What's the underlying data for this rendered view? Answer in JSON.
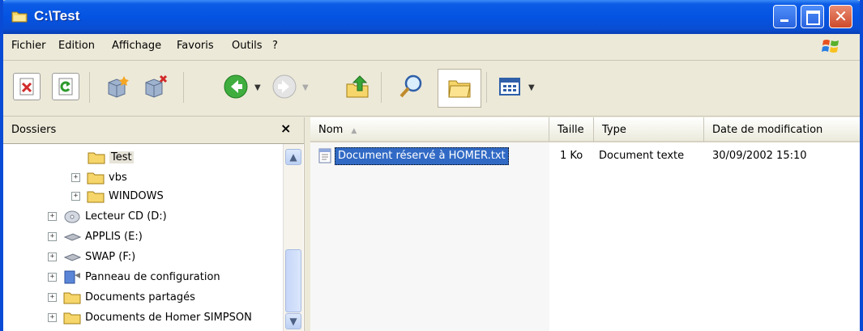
{
  "window": {
    "title": "C:\\Test"
  },
  "menu": [
    "Fichier",
    "Edition",
    "Affichage",
    "Favoris",
    "Outils",
    "?"
  ],
  "folders_pane": {
    "title": "Dossiers",
    "close_glyph": "×",
    "tree": [
      {
        "label": "Test",
        "expander": "",
        "selected": true
      },
      {
        "label": "vbs",
        "expander": "+"
      },
      {
        "label": "WINDOWS",
        "expander": "+"
      },
      {
        "label": "Lecteur CD (D:)",
        "expander": "+"
      },
      {
        "label": "APPLIS (E:)",
        "expander": "+"
      },
      {
        "label": "SWAP (F:)",
        "expander": "+"
      },
      {
        "label": "Panneau de configuration",
        "expander": "+"
      },
      {
        "label": "Documents partagés",
        "expander": "+"
      },
      {
        "label": "Documents de Homer SIMPSON",
        "expander": "+"
      }
    ]
  },
  "list": {
    "columns": [
      "Nom",
      "Taille",
      "Type",
      "Date de modification"
    ],
    "rows": [
      {
        "name": "Document réservé à HOMER.txt",
        "size": "1 Ko",
        "type": "Document texte",
        "modified": "30/09/2002 15:10"
      }
    ]
  }
}
